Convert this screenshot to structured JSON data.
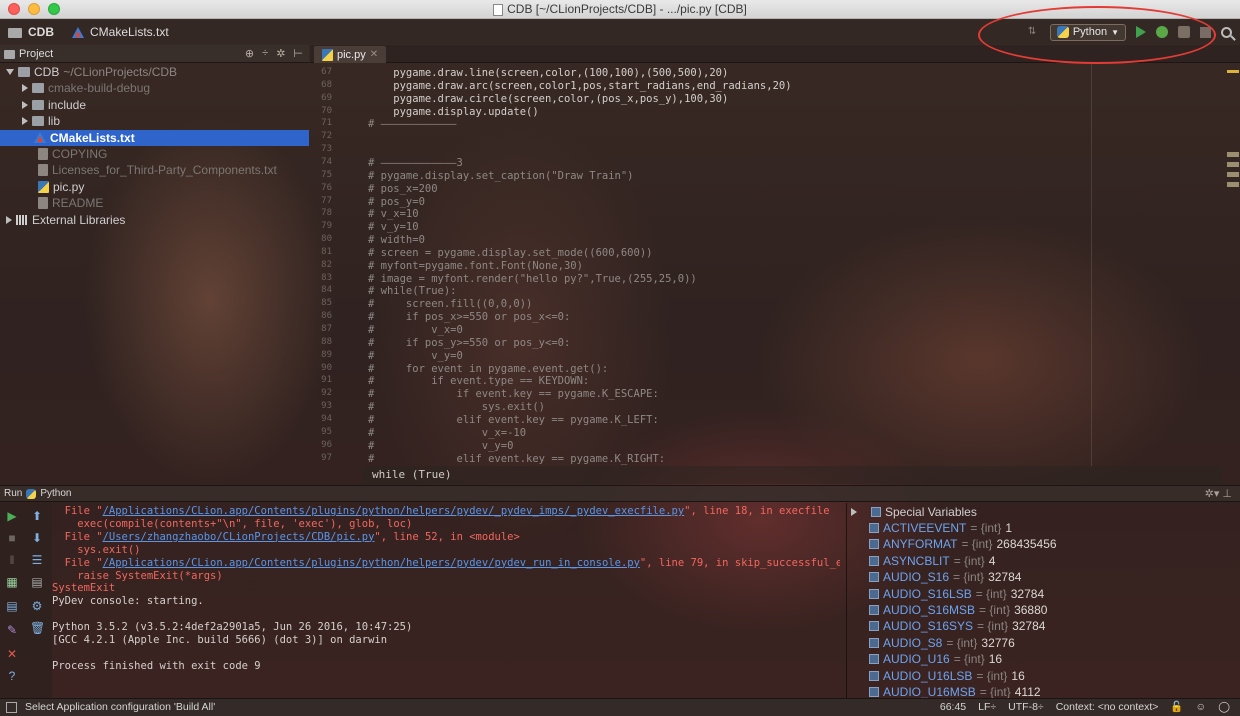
{
  "window": {
    "title": "CDB [~/CLionProjects/CDB] - .../pic.py [CDB]"
  },
  "navbar": {
    "project": "CDB",
    "file": "CMakeLists.txt",
    "run_config": "Python"
  },
  "project_panel": {
    "title": "Project",
    "tree": [
      {
        "label": "CDB",
        "sub": "~/CLionProjects/CDB",
        "type": "folder",
        "level": 0,
        "expanded": true
      },
      {
        "label": "cmake-build-debug",
        "type": "folder",
        "level": 1,
        "expanded": false,
        "dim": true
      },
      {
        "label": "include",
        "type": "folder",
        "level": 1,
        "expanded": false
      },
      {
        "label": "lib",
        "type": "folder",
        "level": 1,
        "expanded": false
      },
      {
        "label": "CMakeLists.txt",
        "type": "cmake",
        "level": 1,
        "selected": true
      },
      {
        "label": "COPYING",
        "type": "doc",
        "level": 1,
        "dim": true
      },
      {
        "label": "Licenses_for_Third-Party_Components.txt",
        "type": "doc",
        "level": 1,
        "dim": true
      },
      {
        "label": "pic.py",
        "type": "py",
        "level": 1
      },
      {
        "label": "README",
        "type": "doc",
        "level": 1,
        "dim": true
      },
      {
        "label": "External Libraries",
        "type": "lib",
        "level": 0,
        "expanded": false
      }
    ]
  },
  "editor": {
    "tab": "pic.py",
    "breadcrumb": "while (True)",
    "lines": [
      {
        "n": "67",
        "text": "    pygame.draw.line(screen,color,(100,100),(500,500),20)",
        "comment": false
      },
      {
        "n": "68",
        "text": "    pygame.draw.arc(screen,color1,pos,start_radians,end_radians,20)",
        "comment": false
      },
      {
        "n": "69",
        "text": "    pygame.draw.circle(screen,color,(pos_x,pos_y),100,30)",
        "comment": false
      },
      {
        "n": "70",
        "text": "    pygame.display.update()",
        "comment": false
      },
      {
        "n": "71",
        "text": "# ————————————",
        "comment": true
      },
      {
        "n": "72",
        "text": "",
        "comment": true
      },
      {
        "n": "73",
        "text": "",
        "comment": true
      },
      {
        "n": "74",
        "text": "# ————————————3",
        "comment": true
      },
      {
        "n": "75",
        "text": "# pygame.display.set_caption(\"Draw Train\")",
        "comment": true
      },
      {
        "n": "76",
        "text": "# pos_x=200",
        "comment": true
      },
      {
        "n": "77",
        "text": "# pos_y=0",
        "comment": true
      },
      {
        "n": "78",
        "text": "# v_x=10",
        "comment": true
      },
      {
        "n": "79",
        "text": "# v_y=10",
        "comment": true
      },
      {
        "n": "80",
        "text": "# width=0",
        "comment": true
      },
      {
        "n": "81",
        "text": "# screen = pygame.display.set_mode((600,600))",
        "comment": true
      },
      {
        "n": "82",
        "text": "# myfont=pygame.font.Font(None,30)",
        "comment": true
      },
      {
        "n": "83",
        "text": "# image = myfont.render(\"hello py?\",True,(255,25,0))",
        "comment": true
      },
      {
        "n": "84",
        "text": "# while(True):",
        "comment": true
      },
      {
        "n": "85",
        "text": "#     screen.fill((0,0,0))",
        "comment": true
      },
      {
        "n": "86",
        "text": "#     if pos_x>=550 or pos_x<=0:",
        "comment": true
      },
      {
        "n": "87",
        "text": "#         v_x=0",
        "comment": true
      },
      {
        "n": "88",
        "text": "#     if pos_y>=550 or pos_y<=0:",
        "comment": true
      },
      {
        "n": "89",
        "text": "#         v_y=0",
        "comment": true
      },
      {
        "n": "90",
        "text": "#     for event in pygame.event.get():",
        "comment": true
      },
      {
        "n": "91",
        "text": "#         if event.type == KEYDOWN:",
        "comment": true
      },
      {
        "n": "92",
        "text": "#             if event.key == pygame.K_ESCAPE:",
        "comment": true
      },
      {
        "n": "93",
        "text": "#                 sys.exit()",
        "comment": true
      },
      {
        "n": "94",
        "text": "#             elif event.key == pygame.K_LEFT:",
        "comment": true
      },
      {
        "n": "95",
        "text": "#                 v_x=-10",
        "comment": true
      },
      {
        "n": "96",
        "text": "#                 v_y=0",
        "comment": true
      },
      {
        "n": "97",
        "text": "#             elif event.key == pygame.K_RIGHT:",
        "comment": true
      }
    ]
  },
  "run_panel": {
    "title": "Run",
    "config": "Python",
    "console": [
      {
        "parts": [
          {
            "t": "  File \"",
            "c": "err"
          },
          {
            "t": "/Applications/CLion.app/Contents/plugins/python/helpers/pydev/_pydev_imps/_pydev_execfile.py",
            "c": "lnk"
          },
          {
            "t": "\", line 18, in execfile",
            "c": "err"
          }
        ]
      },
      {
        "parts": [
          {
            "t": "    exec(compile(contents+\"\\n\", file, 'exec'), glob, loc)",
            "c": "err"
          }
        ]
      },
      {
        "parts": [
          {
            "t": "  File \"",
            "c": "err"
          },
          {
            "t": "/Users/zhangzhaobo/CLionProjects/CDB/pic.py",
            "c": "lnk"
          },
          {
            "t": "\", line 52, in <module>",
            "c": "err"
          }
        ]
      },
      {
        "parts": [
          {
            "t": "    sys.exit()",
            "c": "err"
          }
        ]
      },
      {
        "parts": [
          {
            "t": "  File \"",
            "c": "err"
          },
          {
            "t": "/Applications/CLion.app/Contents/plugins/python/helpers/pydev/pydev_run_in_console.py",
            "c": "lnk"
          },
          {
            "t": "\", line 79, in skip_successful_exit",
            "c": "err"
          }
        ]
      },
      {
        "parts": [
          {
            "t": "    raise SystemExit(*args)",
            "c": "err"
          }
        ]
      },
      {
        "parts": [
          {
            "t": "SystemExit",
            "c": "err"
          }
        ]
      },
      {
        "parts": [
          {
            "t": "PyDev console: starting.",
            "c": ""
          }
        ]
      },
      {
        "parts": [
          {
            "t": "",
            "c": ""
          }
        ]
      },
      {
        "parts": [
          {
            "t": "Python 3.5.2 (v3.5.2:4def2a2901a5, Jun 26 2016, 10:47:25)",
            "c": ""
          }
        ]
      },
      {
        "parts": [
          {
            "t": "[GCC 4.2.1 (Apple Inc. build 5666) (dot 3)] on darwin",
            "c": ""
          }
        ]
      },
      {
        "parts": [
          {
            "t": "",
            "c": ""
          }
        ]
      },
      {
        "parts": [
          {
            "t": "Process finished with exit code 9",
            "c": ""
          }
        ]
      }
    ],
    "variables_title": "Special Variables",
    "variables": [
      {
        "name": "ACTIVEEVENT",
        "type": "{int}",
        "value": "1"
      },
      {
        "name": "ANYFORMAT",
        "type": "{int}",
        "value": "268435456"
      },
      {
        "name": "ASYNCBLIT",
        "type": "{int}",
        "value": "4"
      },
      {
        "name": "AUDIO_S16",
        "type": "{int}",
        "value": "32784"
      },
      {
        "name": "AUDIO_S16LSB",
        "type": "{int}",
        "value": "32784"
      },
      {
        "name": "AUDIO_S16MSB",
        "type": "{int}",
        "value": "36880"
      },
      {
        "name": "AUDIO_S16SYS",
        "type": "{int}",
        "value": "32784"
      },
      {
        "name": "AUDIO_S8",
        "type": "{int}",
        "value": "32776"
      },
      {
        "name": "AUDIO_U16",
        "type": "{int}",
        "value": "16"
      },
      {
        "name": "AUDIO_U16LSB",
        "type": "{int}",
        "value": "16"
      },
      {
        "name": "AUDIO_U16MSB",
        "type": "{int}",
        "value": "4112"
      }
    ]
  },
  "statusbar": {
    "message": "Select Application configuration 'Build All'",
    "position": "66:45",
    "line_sep": "LF",
    "encoding": "UTF-8",
    "context": "Context: <no context>"
  },
  "colors": {
    "accent": "#2f65ca",
    "error": "#f2675e",
    "link": "#5a95e8",
    "annotation": "#e33b35"
  }
}
